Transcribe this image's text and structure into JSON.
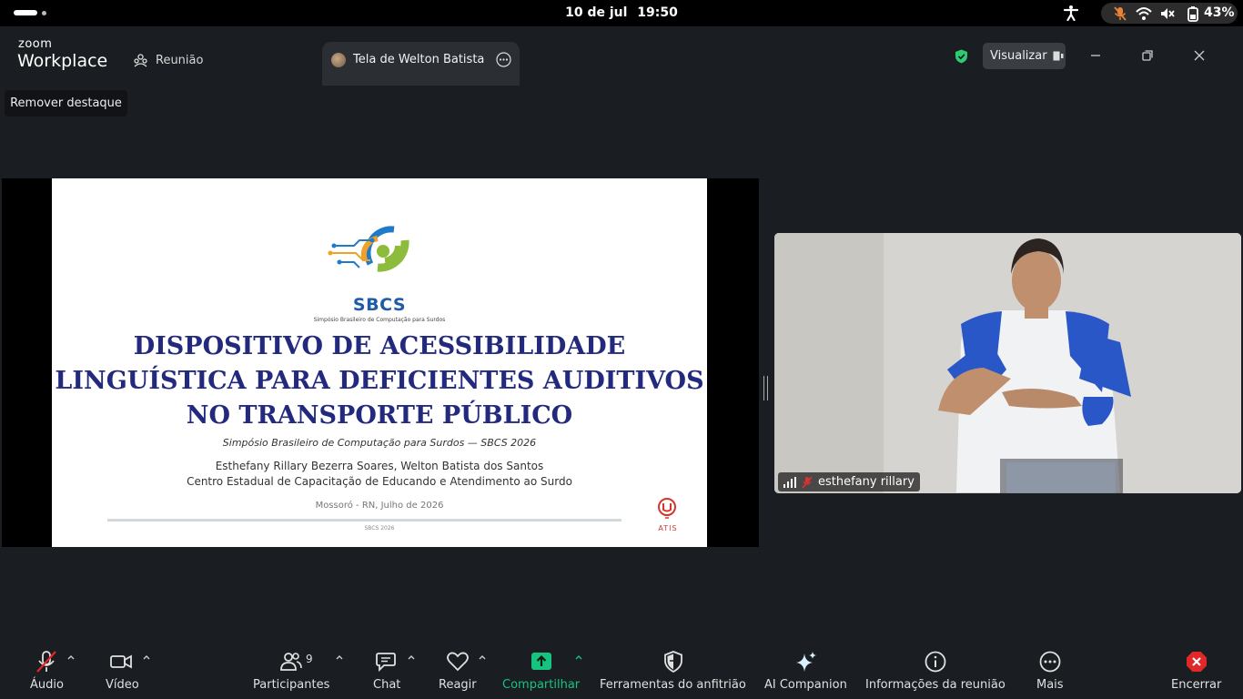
{
  "system_bar": {
    "date": "10 de jul",
    "time": "19:50",
    "battery": "43%",
    "icons": [
      "accessibility-icon",
      "mic-muted-icon",
      "wifi-icon",
      "volume-muted-icon",
      "battery-icon"
    ]
  },
  "app": {
    "brand_top": "zoom",
    "brand_bottom": "Workplace",
    "tab_meeting": "Reunião",
    "tab_share": "Tela de Welton Batista",
    "view_button": "Visualizar",
    "remove_spotlight": "Remover destaque",
    "colors": {
      "background": "#1a1d21",
      "share_green": "#16c47f",
      "shield_green": "#2ecc71",
      "end_red": "#e02828"
    }
  },
  "slide": {
    "logo_text": "SBCS",
    "logo_subtitle": "Simpósio Brasileiro de Computação para Surdos",
    "title_lines": [
      "DISPOSITIVO DE ACESSIBILIDADE",
      "LINGUÍSTICA PARA DEFICIENTES AUDITIVOS",
      "NO TRANSPORTE PÚBLICO"
    ],
    "event": "Simpósio Brasileiro de Computação para Surdos — SBCS 2026",
    "authors": "Esthefany Rillary Bezerra Soares, Welton Batista dos Santos",
    "institution": "Centro Estadual de Capacitação de Educando e Atendimento ao Surdo",
    "place_date": "Mossoró - RN, Julho de 2026",
    "footer": "SBCS 2026",
    "partner_logo_text": "ATIS",
    "title_color": "#232a7e"
  },
  "participant": {
    "name": "esthefany rillary"
  },
  "toolbar": {
    "audio": "Áudio",
    "video": "Vídeo",
    "participants": "Participantes",
    "participants_count": "9",
    "chat": "Chat",
    "react": "Reagir",
    "share": "Compartilhar",
    "host_tools": "Ferramentas do anfitrião",
    "ai_companion": "AI Companion",
    "meeting_info": "Informações da reunião",
    "more": "Mais",
    "end": "Encerrar"
  }
}
